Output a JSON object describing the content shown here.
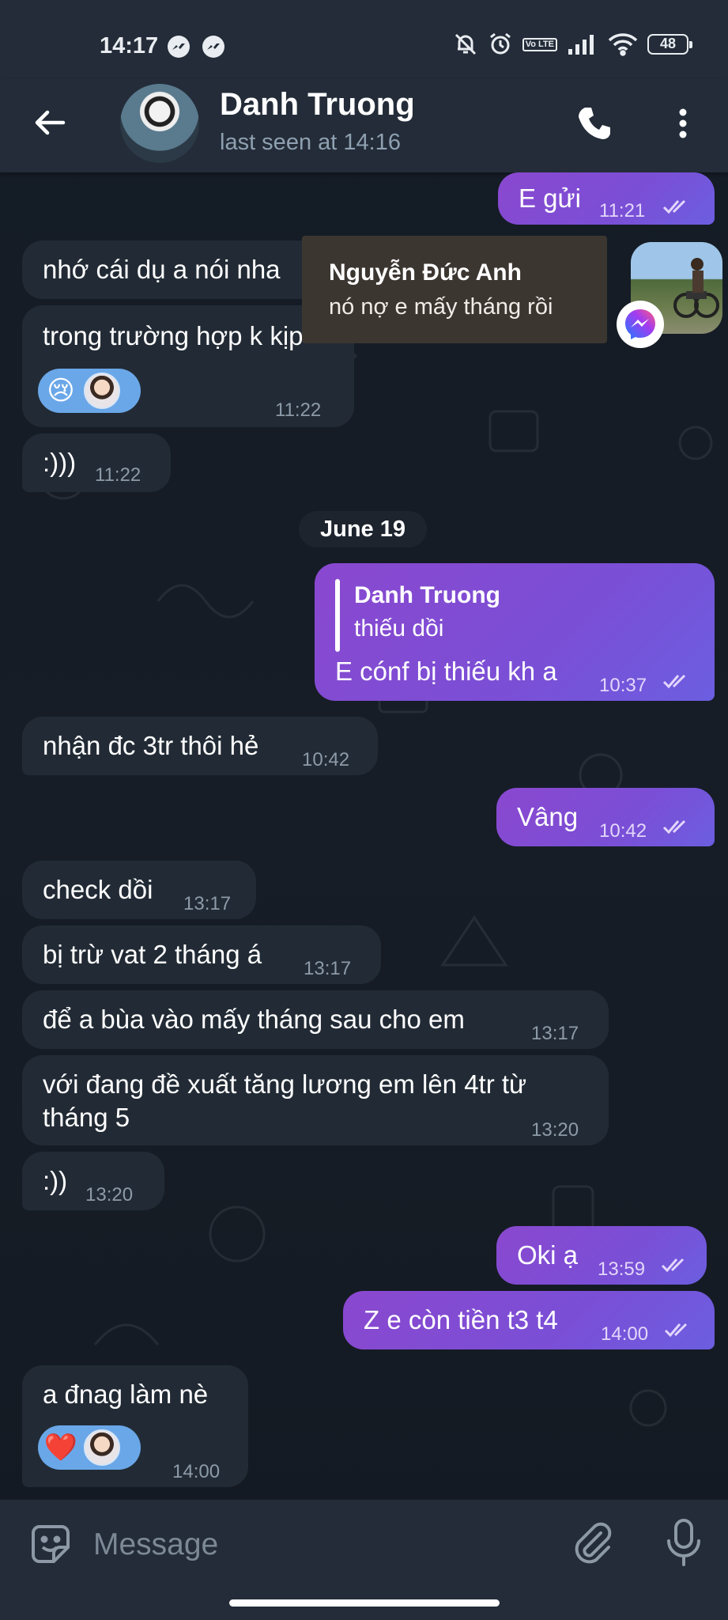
{
  "status_bar": {
    "time": "14:17",
    "battery": "48",
    "volte": "Vo LTE"
  },
  "header": {
    "name": "Danh Truong",
    "last_seen": "last seen at 14:16"
  },
  "notification": {
    "sender": "Nguyễn Đức Anh",
    "text": "nó nợ e mấy tháng rồi"
  },
  "date_divider": "June 19",
  "messages": [
    {
      "dir": "out",
      "text": "E gửi",
      "time": "11:21"
    },
    {
      "dir": "in",
      "text": "nhớ cái dụ a nói nha",
      "time": ""
    },
    {
      "dir": "in",
      "text": "trong trường hợp k kịp",
      "time": "11:22",
      "reaction": "😢"
    },
    {
      "dir": "in",
      "text": ":)))",
      "time": "11:22"
    },
    {
      "dir": "out",
      "reply_name": "Danh Truong",
      "reply_text": "thiếu dồi",
      "text": "E cónf bị thiếu kh a",
      "time": "10:37"
    },
    {
      "dir": "in",
      "text": "nhận đc 3tr thôi hẻ",
      "time": "10:42"
    },
    {
      "dir": "out",
      "text": "Vâng",
      "time": "10:42"
    },
    {
      "dir": "in",
      "text": "check dồi",
      "time": "13:17"
    },
    {
      "dir": "in",
      "text": "bị trừ vat 2 tháng á",
      "time": "13:17"
    },
    {
      "dir": "in",
      "text": "để a bùa vào mấy tháng sau cho em",
      "time": "13:17"
    },
    {
      "dir": "in",
      "text_line1": "với đang đề xuất tăng lương em lên 4tr từ",
      "text_line2": "tháng 5",
      "time": "13:20"
    },
    {
      "dir": "in",
      "text": ":))",
      "time": "13:20"
    },
    {
      "dir": "out",
      "text": "Oki ạ",
      "time": "13:59"
    },
    {
      "dir": "out",
      "text": "Z e còn tiền t3 t4",
      "time": "14:00"
    },
    {
      "dir": "in",
      "text": "a đnag làm nè",
      "time": "14:00",
      "reaction": "❤️"
    }
  ],
  "composer": {
    "placeholder": "Message"
  },
  "colors": {
    "outgoing_bubble": "#8a48cf",
    "incoming_bubble": "#222b35",
    "header": "#232c38",
    "reaction_pill": "#6aa7e8"
  }
}
